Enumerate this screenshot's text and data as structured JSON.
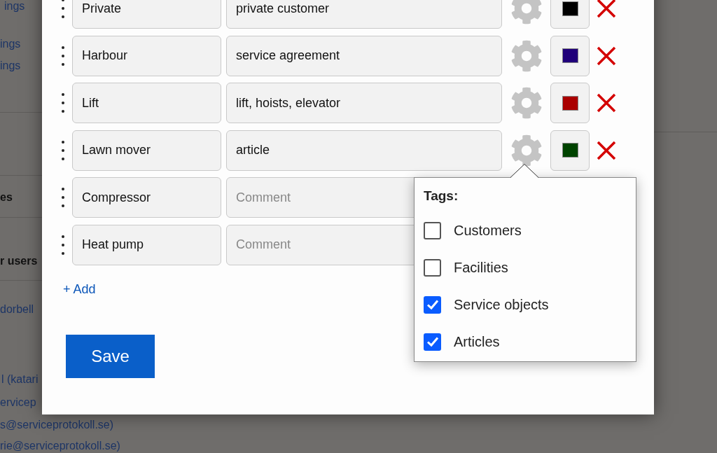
{
  "background_page": {
    "items": [
      {
        "text": "ings",
        "kind": "link"
      },
      {
        "text": "ings",
        "kind": "link"
      },
      {
        "text": "ings",
        "kind": "link"
      },
      {
        "text": "es",
        "kind": "heading"
      },
      {
        "text": "r users",
        "kind": "heading"
      },
      {
        "text": "dorbell",
        "kind": "link"
      },
      {
        "text": "l (katari",
        "kind": "link"
      },
      {
        "text": "ervicep",
        "kind": "link"
      },
      {
        "text": "s@serviceprotokoll.se)",
        "kind": "link"
      },
      {
        "text": "rie@serviceprotokoll.se)",
        "kind": "link"
      }
    ]
  },
  "modal": {
    "rows": [
      {
        "name": "Private",
        "comment": "private customer",
        "color": "#000000"
      },
      {
        "name": "Harbour",
        "comment": "service agreement",
        "color": "#20007a"
      },
      {
        "name": "Lift",
        "comment": "lift, hoists, elevator",
        "color": "#aa0000"
      },
      {
        "name": "Lawn mover",
        "comment": "article",
        "color": "#004400"
      },
      {
        "name": "Compressor",
        "comment_placeholder": "Comment"
      },
      {
        "name": "Heat pump",
        "comment_placeholder": "Comment"
      }
    ],
    "add_link": "+ Add",
    "save_button": "Save"
  },
  "tags_popover": {
    "title": "Tags:",
    "options": [
      {
        "label": "Customers",
        "checked": false
      },
      {
        "label": "Facilities",
        "checked": false
      },
      {
        "label": "Service objects",
        "checked": true
      },
      {
        "label": "Articles",
        "checked": true
      }
    ]
  }
}
